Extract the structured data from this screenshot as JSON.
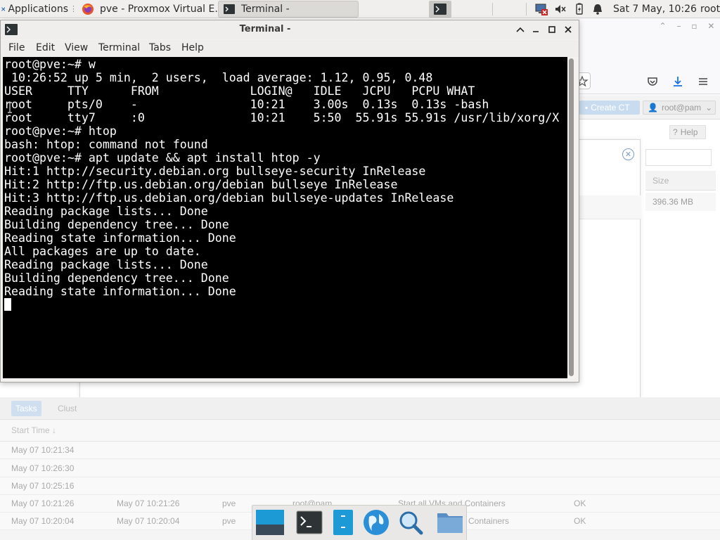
{
  "panel": {
    "applications_label": "Applications",
    "tasks": [
      {
        "title": "pve - Proxmox Virtual E..."
      },
      {
        "title": "Terminal -"
      }
    ],
    "clock": "Sat  7 May, 10:26",
    "user": "root"
  },
  "terminal": {
    "title": "Terminal -",
    "menu": [
      "File",
      "Edit",
      "View",
      "Terminal",
      "Tabs",
      "Help"
    ],
    "lines": [
      "root@pve:~# w",
      " 10:26:52 up 5 min,  2 users,  load average: 1.12, 0.95, 0.48",
      "USER     TTY      FROM             LOGIN@   IDLE   JCPU   PCPU WHAT",
      "root     pts/0    -                10:21    3.00s  0.13s  0.13s -bash",
      "root     tty7     :0               10:21    5:50  55.91s 55.91s /usr/lib/xorg/X",
      "root@pve:~# htop",
      "bash: htop: command not found",
      "root@pve:~# apt update && apt install htop -y",
      "Hit:1 http://security.debian.org bullseye-security InRelease",
      "Hit:2 http://ftp.us.debian.org/debian bullseye InRelease",
      "Hit:3 http://ftp.us.debian.org/debian bullseye-updates InRelease",
      "Reading package lists... Done",
      "Building dependency tree... Done",
      "Reading state information... Done",
      "All packages are up to date.",
      "Reading package lists... Done",
      "Building dependency tree... Done",
      "Reading state information... Done"
    ]
  },
  "proxmox": {
    "create_ct": "Create CT",
    "user_button": "root@pam",
    "help": "Help",
    "size_header": "Size",
    "size_value": "396.36 MB",
    "tabs": [
      "Tasks",
      "Clust"
    ],
    "start_time_header": "Start Time",
    "rows": [
      {
        "start": "May 07 10:21:34",
        "end": "",
        "node": "",
        "user": "",
        "desc": "",
        "status": ""
      },
      {
        "start": "May 07 10:26:30",
        "end": "",
        "node": "",
        "user": "",
        "desc": "",
        "status": ""
      },
      {
        "start": "May 07 10:25:16",
        "end": "",
        "node": "",
        "user": "",
        "desc": "",
        "status": ""
      },
      {
        "start": "May 07 10:21:26",
        "end": "May 07 10:21:26",
        "node": "pve",
        "user": "root@pam",
        "desc": "Start all VMs and Containers",
        "status": "OK"
      },
      {
        "start": "May 07 10:20:04",
        "end": "May 07 10:20:04",
        "node": "pve",
        "user": "",
        "desc": "Containers",
        "status": "OK"
      }
    ]
  },
  "colors": {
    "terminal_bg": "#000000",
    "terminal_fg": "#ffffff",
    "proxmox_accent": "#c9dcef"
  }
}
